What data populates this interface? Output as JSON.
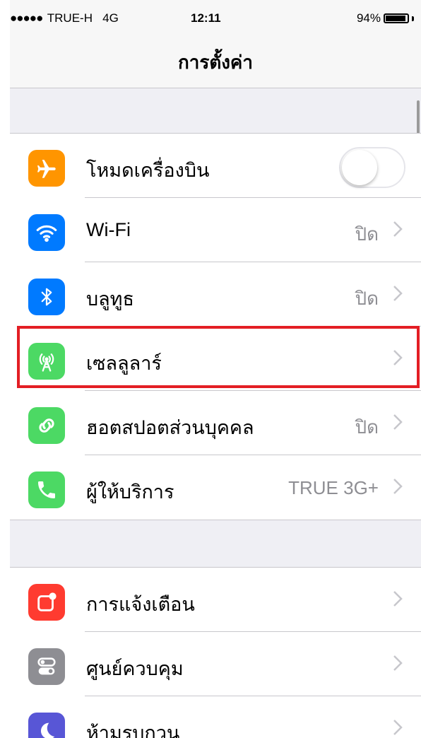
{
  "status_bar": {
    "signal_dots": "●●●●●",
    "carrier": "TRUE-H",
    "network": "4G",
    "time": "12:11",
    "battery": "94%"
  },
  "nav": {
    "title": "การตั้งค่า"
  },
  "group1": {
    "rows": [
      {
        "label": "โหมดเครื่องบิน",
        "icon": "airplane-icon",
        "icon_color": "#ff9500",
        "toggle_on": false
      },
      {
        "label": "Wi-Fi",
        "value": "ปิด",
        "icon": "wifi-icon",
        "icon_color": "#007aff"
      },
      {
        "label": "บลูทูธ",
        "value": "ปิด",
        "icon": "bluetooth-icon",
        "icon_color": "#007aff"
      },
      {
        "label": "เซลลูลาร์",
        "value": "",
        "icon": "cellular-antenna-icon",
        "icon_color": "#4cd964"
      },
      {
        "label": "ฮอตสปอตส่วนบุคคล",
        "value": "ปิด",
        "icon": "hotspot-link-icon",
        "icon_color": "#4cd964"
      },
      {
        "label": "ผู้ให้บริการ",
        "value": "TRUE 3G+",
        "icon": "phone-icon",
        "icon_color": "#4cd964"
      }
    ]
  },
  "group2": {
    "rows": [
      {
        "label": "การแจ้งเตือน",
        "icon": "notifications-icon",
        "icon_color": "#ff3b30"
      },
      {
        "label": "ศูนย์ควบคุม",
        "icon": "control-center-icon",
        "icon_color": "#8e8e93"
      },
      {
        "label": "ห้ามรบกวน",
        "icon": "moon-icon",
        "icon_color": "#5856d6"
      }
    ]
  },
  "highlight_color": "#e31e24"
}
